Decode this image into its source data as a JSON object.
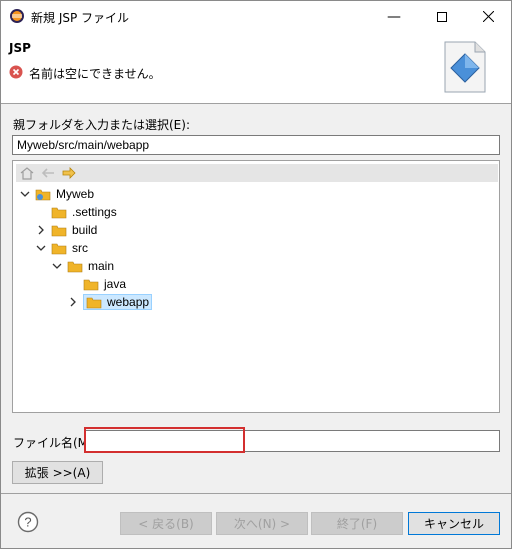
{
  "window": {
    "title": "新規 JSP ファイル"
  },
  "header": {
    "title": "JSP",
    "message": "名前は空にできません。"
  },
  "parent_folder": {
    "label": "親フォルダを入力または選択(E):",
    "value": "Myweb/src/main/webapp"
  },
  "tree": {
    "nodes": [
      {
        "label": "Myweb"
      },
      {
        "label": ".settings"
      },
      {
        "label": "build"
      },
      {
        "label": "src"
      },
      {
        "label": "main"
      },
      {
        "label": "java"
      },
      {
        "label": "webapp"
      }
    ]
  },
  "file_name": {
    "label": "ファイル名(M):",
    "value": ""
  },
  "buttons": {
    "advanced": "拡張 >>(A)",
    "back": "< 戻る(B)",
    "next": "次へ(N) >",
    "finish": "終了(F)",
    "cancel": "キャンセル"
  },
  "colors": {
    "highlight_border": "#d32f2f",
    "selection_bg": "#cce8ff",
    "folder": "#f0b429"
  }
}
